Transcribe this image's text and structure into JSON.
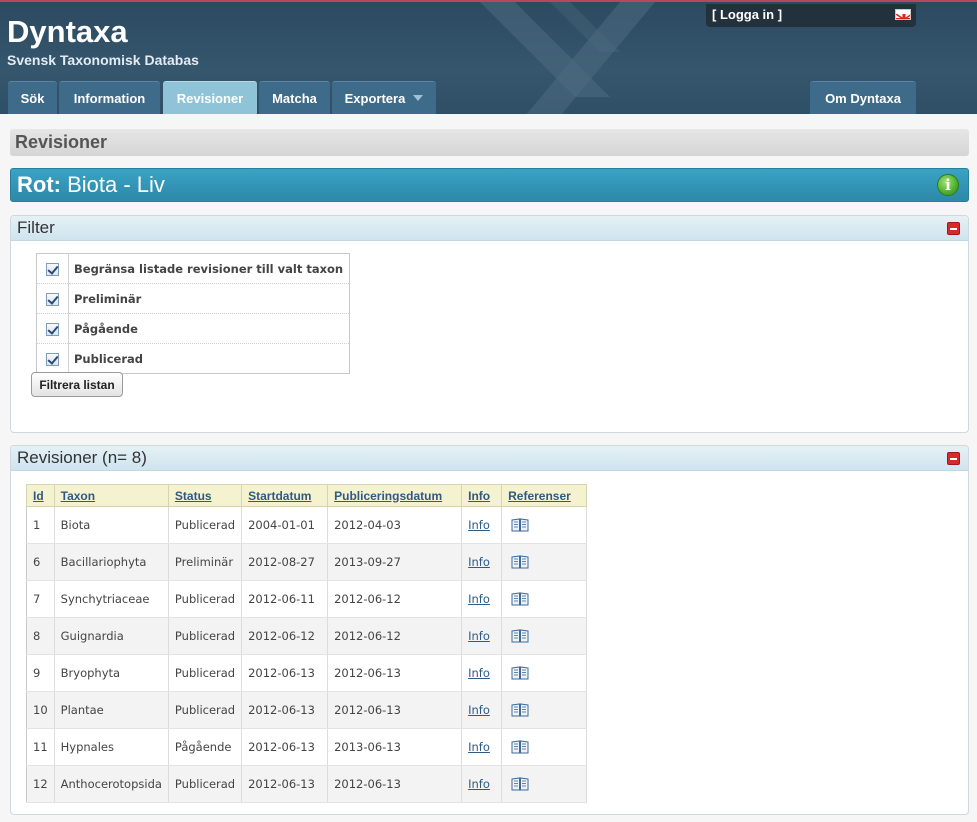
{
  "brand": {
    "title": "Dyntaxa",
    "subtitle": "Svensk Taxonomisk Databas"
  },
  "login": {
    "label": "[ Logga in ]",
    "flag_icon": "uk-flag-icon"
  },
  "nav": {
    "tabs": [
      {
        "label": "Sök",
        "active": false
      },
      {
        "label": "Information",
        "active": false
      },
      {
        "label": "Revisioner",
        "active": true
      },
      {
        "label": "Matcha",
        "active": false
      },
      {
        "label": "Exportera",
        "active": false,
        "dropdown": true
      },
      {
        "label": "Om Dyntaxa",
        "active": false
      }
    ]
  },
  "page": {
    "heading": "Revisioner"
  },
  "root": {
    "prefix": "Rot:",
    "name": "Biota - Liv",
    "info_icon": "info-icon"
  },
  "filter": {
    "title": "Filter",
    "options": [
      {
        "label": "Begränsa listade revisioner till valt taxon",
        "checked": true
      },
      {
        "label": "Preliminär",
        "checked": true
      },
      {
        "label": "Pågående",
        "checked": true
      },
      {
        "label": "Publicerad",
        "checked": true
      }
    ],
    "button_label": "Filtrera listan"
  },
  "revisions": {
    "title": "Revisioner (n= 8)",
    "columns": [
      "Id",
      "Taxon",
      "Status",
      "Startdatum",
      "Publiceringsdatum",
      "Info",
      "Referenser"
    ],
    "rows": [
      {
        "id": "1",
        "taxon": "Biota",
        "status": "Publicerad",
        "start": "2004-01-01",
        "published": "2012-04-03",
        "info": "Info"
      },
      {
        "id": "6",
        "taxon": "Bacillariophyta",
        "status": "Preliminär",
        "start": "2012-08-27",
        "published": "2013-09-27",
        "info": "Info"
      },
      {
        "id": "7",
        "taxon": "Synchytriaceae",
        "status": "Publicerad",
        "start": "2012-06-11",
        "published": "2012-06-12",
        "info": "Info"
      },
      {
        "id": "8",
        "taxon": "Guignardia",
        "status": "Publicerad",
        "start": "2012-06-12",
        "published": "2012-06-12",
        "info": "Info"
      },
      {
        "id": "9",
        "taxon": "Bryophyta",
        "status": "Publicerad",
        "start": "2012-06-13",
        "published": "2012-06-13",
        "info": "Info"
      },
      {
        "id": "10",
        "taxon": "Plantae",
        "status": "Publicerad",
        "start": "2012-06-13",
        "published": "2012-06-13",
        "info": "Info"
      },
      {
        "id": "11",
        "taxon": "Hypnales",
        "status": "Pågående",
        "start": "2012-06-13",
        "published": "2013-06-13",
        "info": "Info"
      },
      {
        "id": "12",
        "taxon": "Anthocerotopsida",
        "status": "Publicerad",
        "start": "2012-06-13",
        "published": "2012-06-13",
        "info": "Info"
      }
    ]
  },
  "colors": {
    "header": "#35566d",
    "tab": "#3f6b8b",
    "tab_active": "#8fc3d7",
    "root_bar": "#3aa3c4",
    "table_header": "#f5f2cf"
  }
}
